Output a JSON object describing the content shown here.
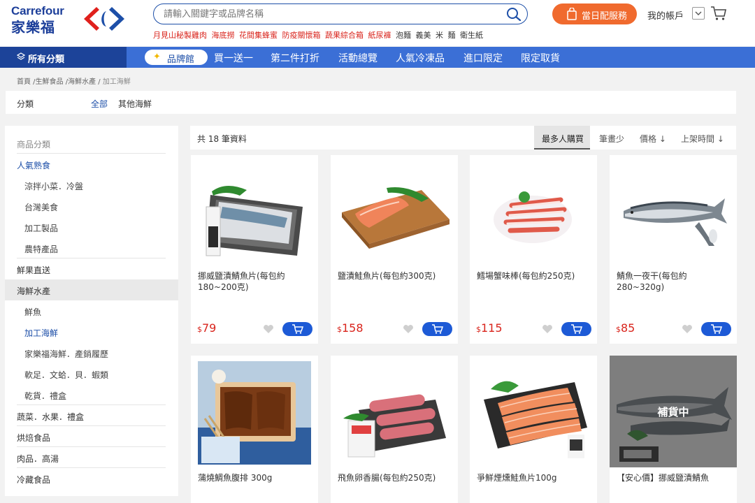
{
  "header": {
    "logo_en": "Carrefour",
    "logo_zh": "家樂福",
    "search_placeholder": "請輸入關鍵字或品牌名稱",
    "hot_keywords": [
      "月見山秘製雞肉",
      "海底撈",
      "花間集蜂蜜",
      "防疫關懷箱",
      "蔬果綜合箱",
      "紙尿褲",
      "泡麵",
      "義美",
      "米",
      "麵",
      "衛生紙"
    ],
    "delivery_label": "當日配服務",
    "account_label": "我的帳戶"
  },
  "nav": {
    "all_categories": "所有分類",
    "brand_label": "品牌館",
    "links": [
      "買一送一",
      "第二件打折",
      "活動總覽",
      "人氣冷凍品",
      "進口限定",
      "限定取貨"
    ]
  },
  "breadcrumb": [
    "首頁",
    "生鮮食品",
    "海鮮水產",
    "加工海鮮"
  ],
  "filter": {
    "label": "分類",
    "options": [
      "全部",
      "其他海鮮"
    ]
  },
  "sidebar": {
    "title": "商品分類",
    "items": [
      {
        "label": "人氣熟食"
      },
      {
        "label": "涼拌小菜．冷盤"
      },
      {
        "label": "台灣美食"
      },
      {
        "label": "加工製品"
      },
      {
        "label": "農特產品"
      },
      {
        "label": "鮮果直送"
      },
      {
        "label": "海鮮水產"
      },
      {
        "label": "鮮魚"
      },
      {
        "label": "加工海鮮"
      },
      {
        "label": "家樂福海鮮．產銷履歷"
      },
      {
        "label": "軟足．文蛤．貝．蝦類"
      },
      {
        "label": "乾貨．禮盒"
      },
      {
        "label": "蔬菜．水果．禮盒"
      },
      {
        "label": "烘焙食品"
      },
      {
        "label": "肉品．高湯"
      },
      {
        "label": "冷藏食品"
      }
    ]
  },
  "listing": {
    "count_text": "共 18 筆資料",
    "sort_options": [
      "最多人購買",
      "筆畫少",
      "價格 ↓",
      "上架時間 ↓"
    ]
  },
  "products": [
    {
      "name": "挪威鹽漬鯖魚片(每包約180~200克)",
      "currency": "$",
      "price": "79"
    },
    {
      "name": "鹽漬鮭魚片(每包約300克)",
      "currency": "$",
      "price": "158"
    },
    {
      "name": "鱈場蟹味棒(每包約250克)",
      "currency": "$",
      "price": "115"
    },
    {
      "name": "鯖魚一夜干(每包約280~320g)",
      "currency": "$",
      "price": "85"
    },
    {
      "name": "蒲燒鯛魚腹排 300g"
    },
    {
      "name": "飛魚卵香腸(每包約250克)"
    },
    {
      "name": "爭鮮煙燻鮭魚片100g"
    },
    {
      "name": "【安心價】挪威鹽漬鯖魚",
      "status": "補貨中"
    }
  ],
  "colors": {
    "brand_blue": "#1d4fa8",
    "nav_blue": "#3b6fd6",
    "nav_dark": "#1c4399",
    "orange": "#f06a2e",
    "price_red": "#d9241c",
    "cart_blue": "#1d5ad6"
  }
}
